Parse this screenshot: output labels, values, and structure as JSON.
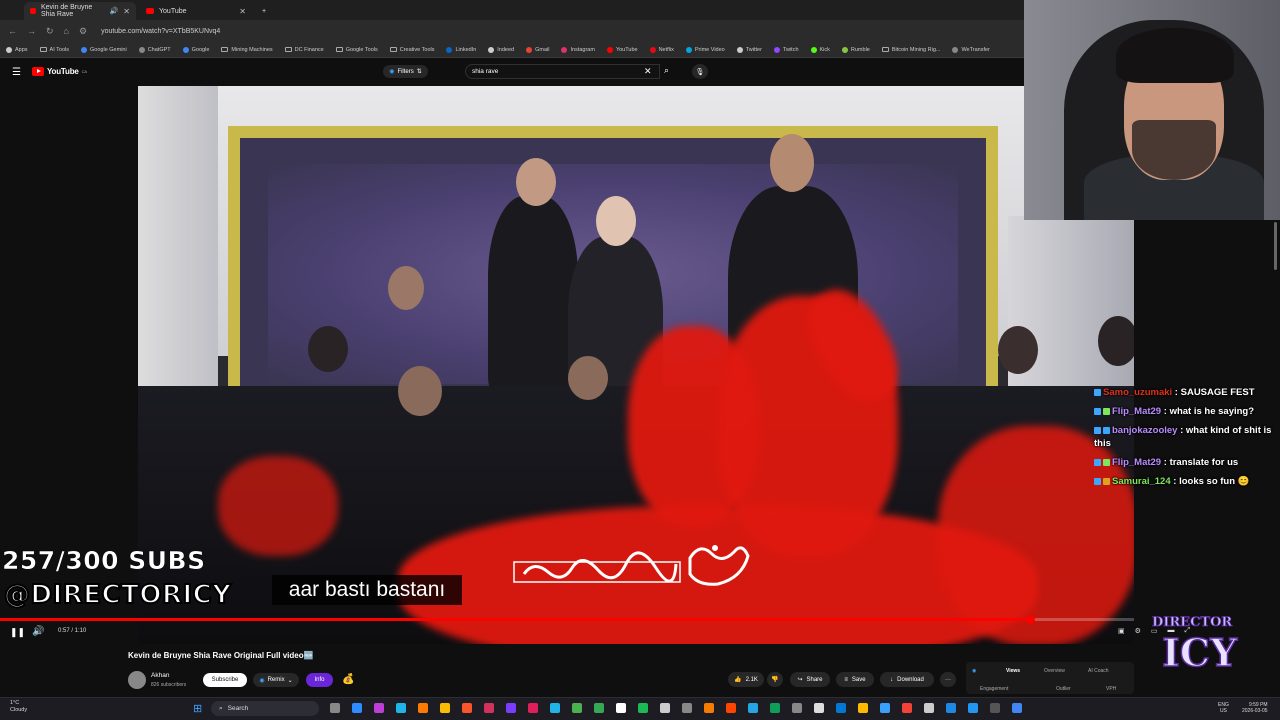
{
  "browser": {
    "tabs": [
      {
        "title": "Kevin de Bruyne Shia Rave",
        "active": true
      },
      {
        "title": "YouTube",
        "active": false
      }
    ],
    "new_tab": "+",
    "url": "youtube.com/watch?v=XTbB5KUNvq4",
    "bookmarks": [
      "Apps",
      "AI Tools",
      "Google Gemini",
      "ChatGPT",
      "Google",
      "Mining Machines",
      "DC Finance",
      "Google Tools",
      "Creative Tools",
      "LinkedIn",
      "Indeed",
      "Gmail",
      "Instagram",
      "YouTube",
      "Netflix",
      "Prime Video",
      "Twitter",
      "Twitch",
      "Kick",
      "Rumble",
      "Bitcoin Mining Rig...",
      "WeTransfer"
    ]
  },
  "youtube": {
    "logo_text": "YouTube",
    "logo_region": "CA",
    "filters_label": "Filters",
    "search_value": "shia rave"
  },
  "video": {
    "subtitle": "aar bastı bastanı",
    "time": "0:57 / 1:10",
    "progress": 0.908
  },
  "stream_overlay": {
    "subs_count": "257/300 SUBS",
    "handle": "@DIRECTORICY",
    "logo_text": "DIRECTOR ICY"
  },
  "chat": [
    {
      "user": "Samo_uzumaki",
      "message": "SAUSAGE FEST",
      "color": "#e0301e"
    },
    {
      "user": "Flip_Mat29",
      "message": "what is he saying?",
      "color": "#b98cff"
    },
    {
      "user": "banjokazooley",
      "message": "what kind of shit is this",
      "color": "#b98cff"
    },
    {
      "user": "Flip_Mat29",
      "message": "translate for us",
      "color": "#b98cff"
    },
    {
      "user": "Samurai_124",
      "message": "looks so fun 😊",
      "color": "#7ee65a"
    }
  ],
  "watch": {
    "title": "Kevin de Bruyne Shia Rave Original Full video🆕",
    "channel_name": "Akhan",
    "channel_subs": "826 subscribers",
    "subscribe_label": "Subscribe",
    "remix_label": "Remix",
    "info_label": "Info",
    "likes": "2.1K",
    "share_label": "Share",
    "save_label": "Save",
    "download_label": "Download",
    "more": "···"
  },
  "analytics": {
    "tabs": [
      "Views",
      "Overview",
      "AI Coach"
    ],
    "sub_labels": [
      "Engagement",
      "Outlier",
      "VPH"
    ]
  },
  "taskbar": {
    "weather_temp": "1°C",
    "weather_desc": "Cloudy",
    "search_placeholder": "Search",
    "lang": "ENG",
    "region": "US",
    "time": "9:59 PM",
    "date": "2026-03-05"
  }
}
